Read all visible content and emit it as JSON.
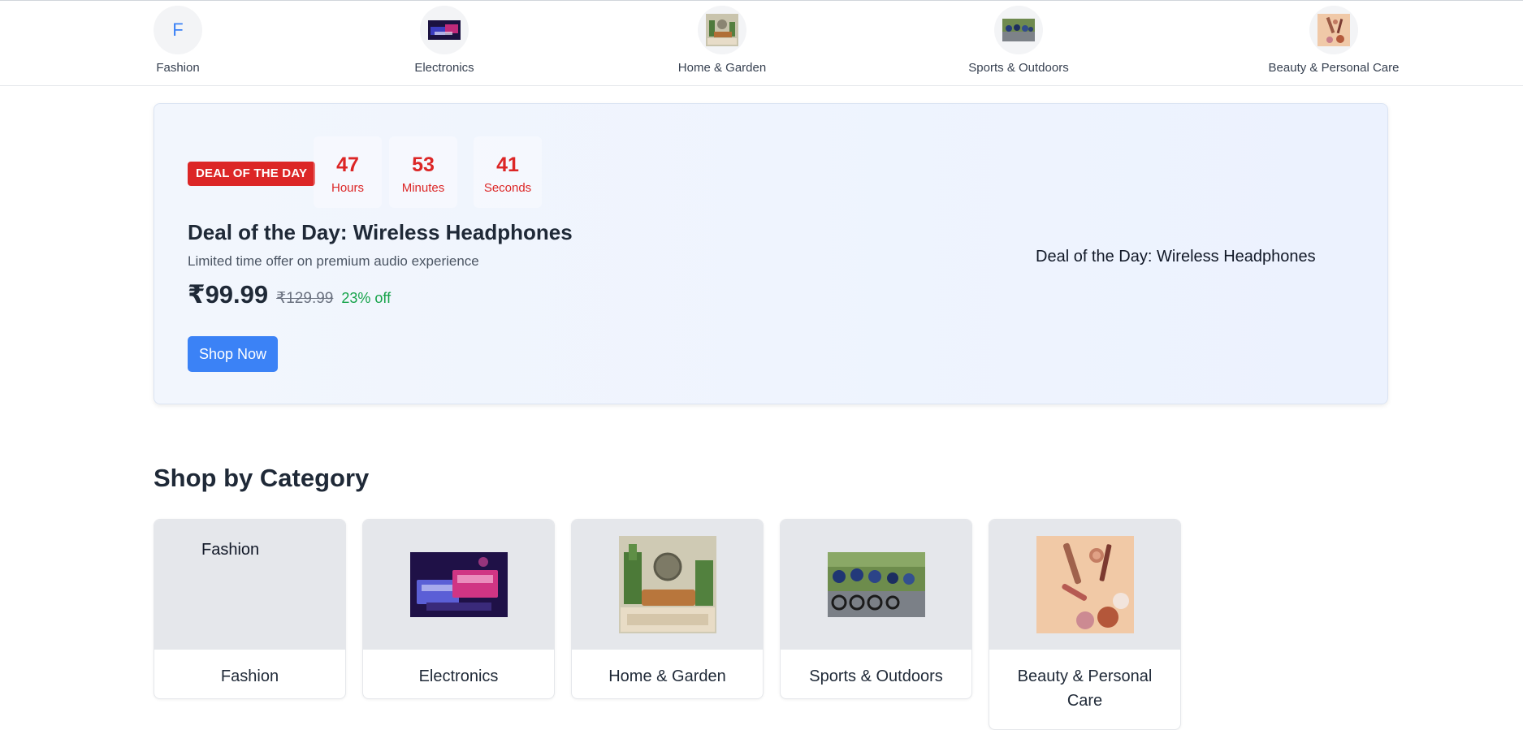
{
  "top_nav": {
    "items": [
      {
        "label": "Fashion",
        "placeholder_letter": "F"
      },
      {
        "label": "Electronics"
      },
      {
        "label": "Home & Garden"
      },
      {
        "label": "Sports & Outdoors"
      },
      {
        "label": "Beauty & Personal Care"
      }
    ]
  },
  "deal": {
    "badge": "DEAL OF THE DAY",
    "countdown": [
      {
        "value": "47",
        "unit": "Hours"
      },
      {
        "value": "53",
        "unit": "Minutes"
      },
      {
        "value": "41",
        "unit": "Seconds"
      }
    ],
    "title": "Deal of the Day: Wireless Headphones",
    "subtitle": "Limited time offer on premium audio experience",
    "price": "₹99.99",
    "old_price": "₹129.99",
    "discount": "23% off",
    "button": "Shop Now",
    "image_alt": "Deal of the Day: Wireless Headphones"
  },
  "categories": {
    "title": "Shop by Category",
    "items": [
      {
        "label": "Fashion",
        "image_alt": "Fashion"
      },
      {
        "label": "Electronics"
      },
      {
        "label": "Home & Garden"
      },
      {
        "label": "Sports & Outdoors"
      },
      {
        "label": "Beauty & Personal Care"
      }
    ]
  },
  "colors": {
    "accent": "#3b82f6",
    "deal_red": "#dc2626",
    "discount_green": "#16a34a",
    "banner_bg": "#eef3fd"
  }
}
